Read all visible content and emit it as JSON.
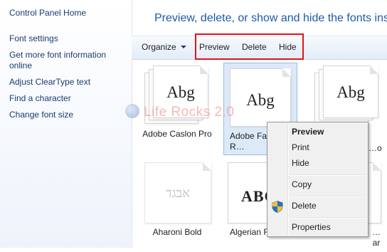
{
  "sidebar": {
    "home": "Control Panel Home",
    "links": [
      "Font settings",
      "Get more font information online",
      "Adjust ClearType text",
      "Find a character",
      "Change font size"
    ]
  },
  "main": {
    "title": "Preview, delete, or show and hide the fonts installed on your computer"
  },
  "toolbar": {
    "organize": "Organize",
    "preview": "Preview",
    "delete": "Delete",
    "hide": "Hide"
  },
  "fonts": [
    {
      "sample": "Abg",
      "name": "Adobe Caslon Pro"
    },
    {
      "sample": "Abg",
      "name": "Adobe Far… Std R…"
    },
    {
      "sample": "Abg",
      "name": "…o"
    },
    {
      "sample": "אבגד",
      "name": "Aharoni Bold"
    },
    {
      "sample": "ABG",
      "name": "Algerian R…"
    },
    {
      "sample": "",
      "name": "…ar"
    }
  ],
  "watermark": "Life Rocks 2.0",
  "context_menu": {
    "items": [
      "Preview",
      "Print",
      "Hide",
      "Copy",
      "Delete",
      "Properties"
    ]
  },
  "colors": {
    "accent_title": "#1e5aa8",
    "highlight": "#e0141b",
    "selection": "#dce9f9"
  }
}
